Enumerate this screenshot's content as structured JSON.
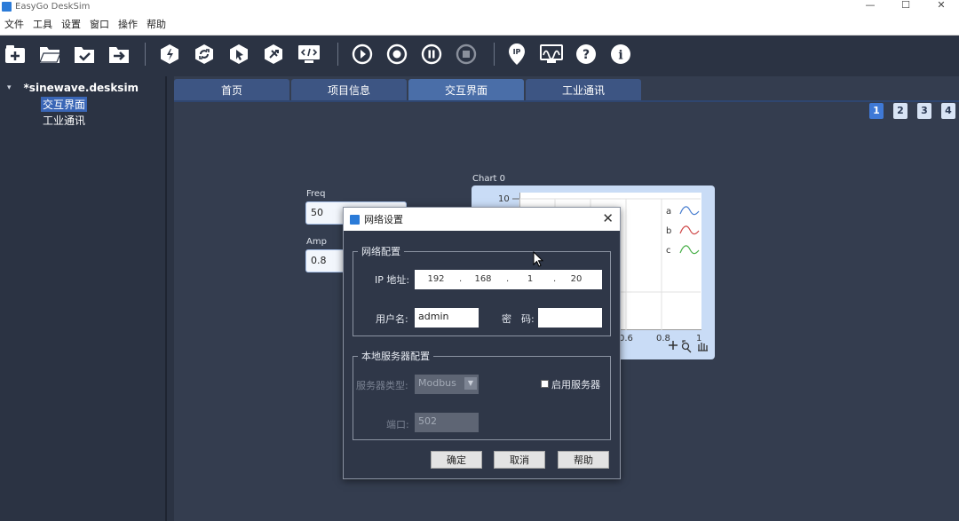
{
  "window": {
    "title": "EasyGo DeskSim",
    "minimize": "—",
    "maximize": "☐",
    "close": "✕"
  },
  "menu": [
    "文件",
    "工具",
    "设置",
    "窗口",
    "操作",
    "帮助"
  ],
  "toolbar": {
    "buttons": [
      "new-file-icon",
      "open-folder-icon",
      "save-icon",
      "export-icon",
      "build-icon",
      "refresh-icon",
      "select-cursor-icon",
      "debug-icon",
      "code-window-icon",
      "play-icon",
      "record-icon",
      "pause-icon",
      "stop-icon",
      "ip-location-icon",
      "oscilloscope-icon",
      "help-icon",
      "info-icon"
    ]
  },
  "tree": {
    "root": "*sinewave.desksim",
    "children": [
      "交互界面",
      "工业通讯"
    ],
    "selected_index": 0
  },
  "tabs": [
    "首页",
    "项目信息",
    "交互界面",
    "工业通讯"
  ],
  "active_tab": 2,
  "pages": [
    "1",
    "2",
    "3",
    "4"
  ],
  "active_page": 0,
  "widgets": {
    "freq_label": "Freq",
    "freq_value": "50",
    "amp_label": "Amp",
    "amp_value": "0.8"
  },
  "chart_data": {
    "type": "line",
    "title": "Chart 0",
    "y_tick_visible": "10",
    "x_ticks_visible": [
      "0.6",
      "0.8",
      "1"
    ],
    "legend": [
      "a",
      "b",
      "c"
    ],
    "legend_colors": [
      "#4a7fd0",
      "#d04a4a",
      "#4ab04a"
    ],
    "legend_placement": "top-right",
    "tools": [
      "zoom-plus-icon",
      "zoom-select-icon",
      "pan-hand-icon"
    ]
  },
  "dialog": {
    "title": "网络设置",
    "close": "✕",
    "network_group": "网络配置",
    "ip_label": "IP 地址:",
    "ip": [
      "192",
      "168",
      "1",
      "20"
    ],
    "user_label": "用户名:",
    "user_value": "admin",
    "password_label": "密　码:",
    "password_value": "",
    "server_group": "本地服务器配置",
    "server_type_label": "服务器类型:",
    "server_type_value": "Modbus",
    "enable_server_label": "启用服务器",
    "port_label": "端口:",
    "port_value": "502",
    "ok": "确定",
    "cancel": "取消",
    "help": "帮助"
  }
}
